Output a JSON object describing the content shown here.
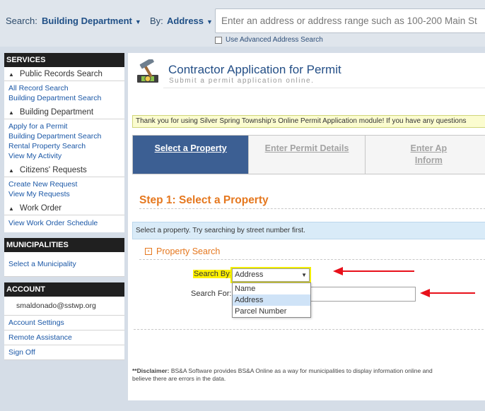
{
  "search_bar": {
    "search_label": "Search:",
    "search_value": "Building Department",
    "by_label": "By:",
    "by_value": "Address",
    "placeholder": "Enter an address or address range such as 100-200 Main St",
    "advanced_label": "Use Advanced Address Search"
  },
  "sidebar": {
    "services": {
      "title": "SERVICES",
      "groups": [
        {
          "label": "Public Records Search",
          "items": [
            "All Record Search",
            "Building Department Search"
          ]
        },
        {
          "label": "Building Department",
          "items": [
            "Apply for a Permit",
            "Building Department Search",
            "Rental Property Search",
            "View My Activity"
          ]
        },
        {
          "label": "Citizens' Requests",
          "items": [
            "Create New Request",
            "View My Requests"
          ]
        },
        {
          "label": "Work Order",
          "items": [
            "View Work Order Schedule"
          ]
        }
      ]
    },
    "municipalities": {
      "title": "MUNICIPALITIES",
      "item": "Select a Municipality"
    },
    "account": {
      "title": "ACCOUNT",
      "user": "smaldonado@sstwp.org",
      "items": [
        "Account Settings",
        "Remote Assistance",
        "Sign Off"
      ]
    }
  },
  "main": {
    "title": "Contractor Application for Permit",
    "subtitle": "Submit a permit application online.",
    "banner": "Thank you for using Silver Spring Township's Online Permit Application module! If you have any questions",
    "steps": {
      "step1": "Select a Property",
      "step2": "Enter Permit Details",
      "step3_line1": "Enter Ap",
      "step3_line2": "Inform"
    },
    "step_heading": "Step 1: Select a Property",
    "info": "Select a property. Try searching by street number first.",
    "property_search": {
      "toggle": "-",
      "title": "Property Search",
      "search_by_label": "Search By:",
      "search_by_value": "Address",
      "options": [
        "Name",
        "Address",
        "Parcel Number"
      ],
      "search_for_label": "Search For:"
    },
    "disclaimer": {
      "bold": "**Disclaimer:",
      "line1": " BS&A Software provides BS&A Online as a way for municipalities to display information online and",
      "line2": "believe there are errors in the data."
    }
  },
  "colors": {
    "nav_blue": "#1a57a6",
    "step_active": "#3c5f93",
    "accent_orange": "#e5781f",
    "highlight_yellow": "#fff200",
    "annotation_red": "#e8101a"
  }
}
